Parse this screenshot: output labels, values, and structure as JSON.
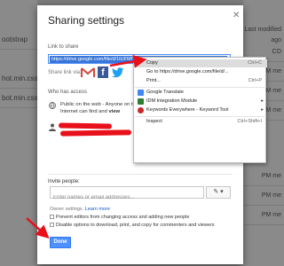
{
  "background": {
    "left_rows": [
      "ootstrap",
      "hot.min.css",
      "bot.min.css"
    ],
    "right_header": [
      "Last modified",
      "ago"
    ],
    "right_rows": [
      "CO",
      "PM me",
      "PM me",
      "PM me",
      "PM me",
      "PM me",
      "PM me"
    ]
  },
  "dialog": {
    "title": "Sharing settings",
    "link_label": "Link to share",
    "link_value": "https://drive.google.com/file/d/1tUFMfY...-view?usp=sharing",
    "share_via_label": "Share link via:",
    "who_label": "Who has access",
    "access_line1": "Public on the web - Anyone on the",
    "access_line2": "Internet can find and",
    "access_mode": "view",
    "invite_label": "Invite people:",
    "invite_placeholder": "Enter names or email addresses...",
    "pencil_label": "✎ ▾",
    "owner_settings_label": "Owner settings",
    "learn_more": "Learn more",
    "option1": "Prevent editors from changing access and adding new people",
    "option2": "Disable options to download, print, and copy for commenters and viewers",
    "done_label": "Done"
  },
  "context_menu": {
    "copy": "Copy",
    "copy_shortcut": "Ctrl+C",
    "goto": "Go to https://drive.google.com/file/d/...",
    "print": "Print...",
    "print_shortcut": "Ctrl+P",
    "translate": "Google Translate",
    "idm": "IDM Integration Module",
    "keywords": "Keywords Everywhere - Keyword Tool",
    "inspect": "Inspect",
    "inspect_shortcut": "Ctrl+Shift+I"
  },
  "colors": {
    "accent": "#4d90fe",
    "redaction": "#e8101a",
    "arrow": "#e8101a"
  }
}
